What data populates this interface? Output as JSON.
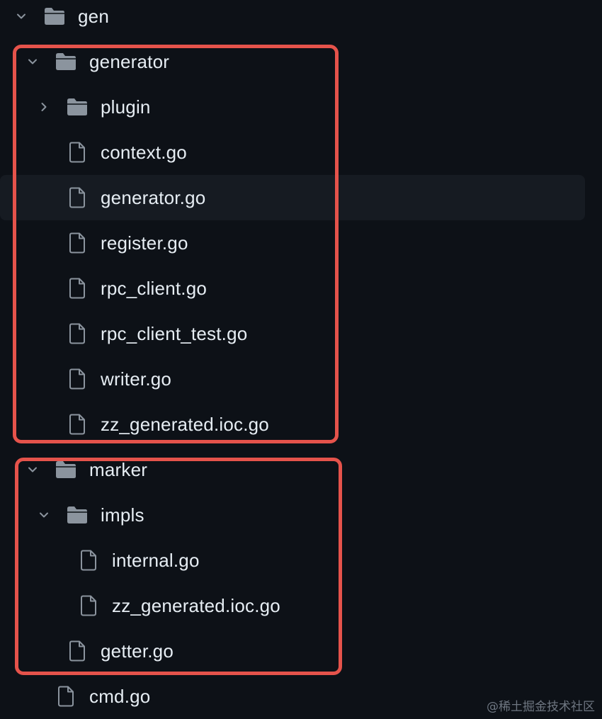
{
  "tree": [
    {
      "name": "gen",
      "type": "folder",
      "expanded": true,
      "depth": 0
    },
    {
      "name": "generator",
      "type": "folder",
      "expanded": true,
      "depth": 1
    },
    {
      "name": "plugin",
      "type": "folder",
      "expanded": false,
      "depth": 2
    },
    {
      "name": "context.go",
      "type": "file",
      "depth": 2
    },
    {
      "name": "generator.go",
      "type": "file",
      "depth": 2,
      "hovered": true
    },
    {
      "name": "register.go",
      "type": "file",
      "depth": 2
    },
    {
      "name": "rpc_client.go",
      "type": "file",
      "depth": 2
    },
    {
      "name": "rpc_client_test.go",
      "type": "file",
      "depth": 2
    },
    {
      "name": "writer.go",
      "type": "file",
      "depth": 2
    },
    {
      "name": "zz_generated.ioc.go",
      "type": "file",
      "depth": 2
    },
    {
      "name": "marker",
      "type": "folder",
      "expanded": true,
      "depth": 1
    },
    {
      "name": "impls",
      "type": "folder",
      "expanded": true,
      "depth": 2
    },
    {
      "name": "internal.go",
      "type": "file",
      "depth": 3
    },
    {
      "name": "zz_generated.ioc.go",
      "type": "file",
      "depth": 3
    },
    {
      "name": "getter.go",
      "type": "file",
      "depth": 2
    },
    {
      "name": "cmd.go",
      "type": "file",
      "depth": 1
    }
  ],
  "watermark": "@稀土掘金技术社区",
  "colors": {
    "background": "#0d1117",
    "hover": "#161b22",
    "icon": "#8b949e",
    "text": "#e6edf3",
    "highlight": "#e5534b"
  }
}
